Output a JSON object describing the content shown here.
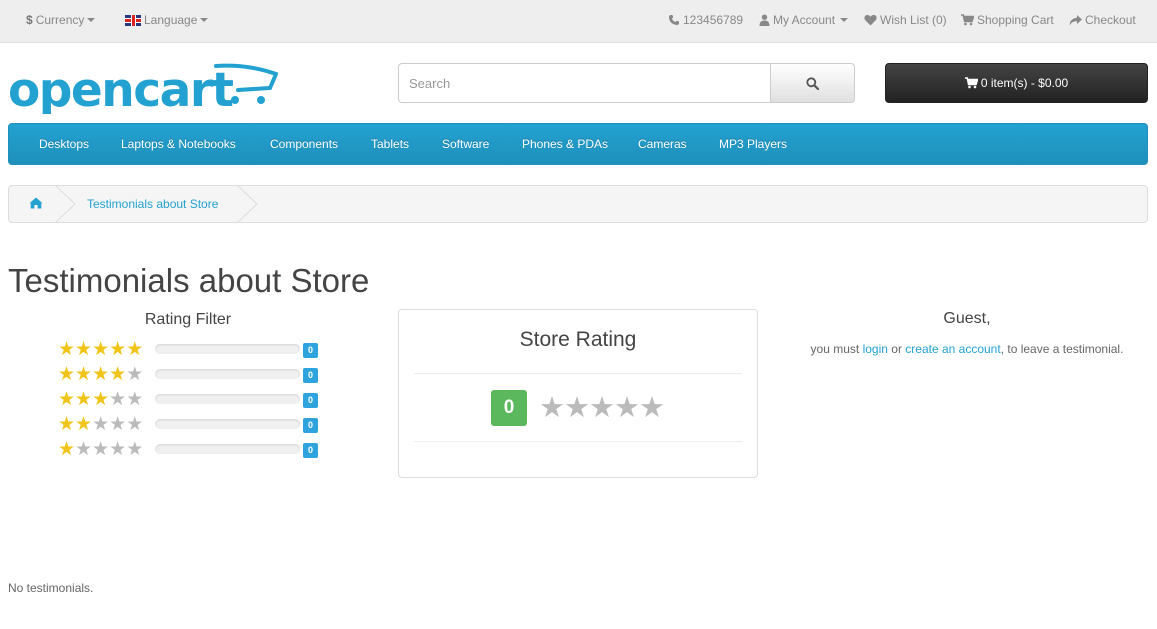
{
  "topbar": {
    "currency_symbol": "$",
    "currency_label": "Currency",
    "language_label": "Language",
    "phone": "123456789",
    "my_account": "My Account",
    "wish_list": "Wish List (0)",
    "shopping_cart": "Shopping Cart",
    "checkout": "Checkout"
  },
  "header": {
    "logo_text": "opencart",
    "search_placeholder": "Search",
    "cart_label": "0 item(s) - $0.00"
  },
  "menu": {
    "items": [
      {
        "label": "Desktops"
      },
      {
        "label": "Laptops & Notebooks"
      },
      {
        "label": "Components"
      },
      {
        "label": "Tablets"
      },
      {
        "label": "Software"
      },
      {
        "label": "Phones & PDAs"
      },
      {
        "label": "Cameras"
      },
      {
        "label": "MP3 Players"
      }
    ]
  },
  "breadcrumb": {
    "current": "Testimonials about Store"
  },
  "page": {
    "title": "Testimonials about Store",
    "no_testimonials": "No testimonials."
  },
  "rating_filter": {
    "title": "Rating Filter",
    "rows": [
      {
        "stars": 5,
        "count": "0",
        "fill": 0
      },
      {
        "stars": 4,
        "count": "0",
        "fill": 0
      },
      {
        "stars": 3,
        "count": "0",
        "fill": 0
      },
      {
        "stars": 2,
        "count": "0",
        "fill": 0
      },
      {
        "stars": 1,
        "count": "0",
        "fill": 0
      }
    ]
  },
  "store_rating": {
    "title": "Store Rating",
    "value": "0",
    "stars_filled": 0
  },
  "guest": {
    "title": "Guest,",
    "text_before": "you must",
    "login_link": "login",
    "text_or": "or",
    "create_account_link": "create an account",
    "text_after": ", to leave a testimonial."
  },
  "colors": {
    "accent": "#23a1d1",
    "star_on": "#f0c419",
    "star_off": "#bbbbbb",
    "rating_badge": "#5cb85c",
    "count_badge": "#2ea3dd"
  }
}
